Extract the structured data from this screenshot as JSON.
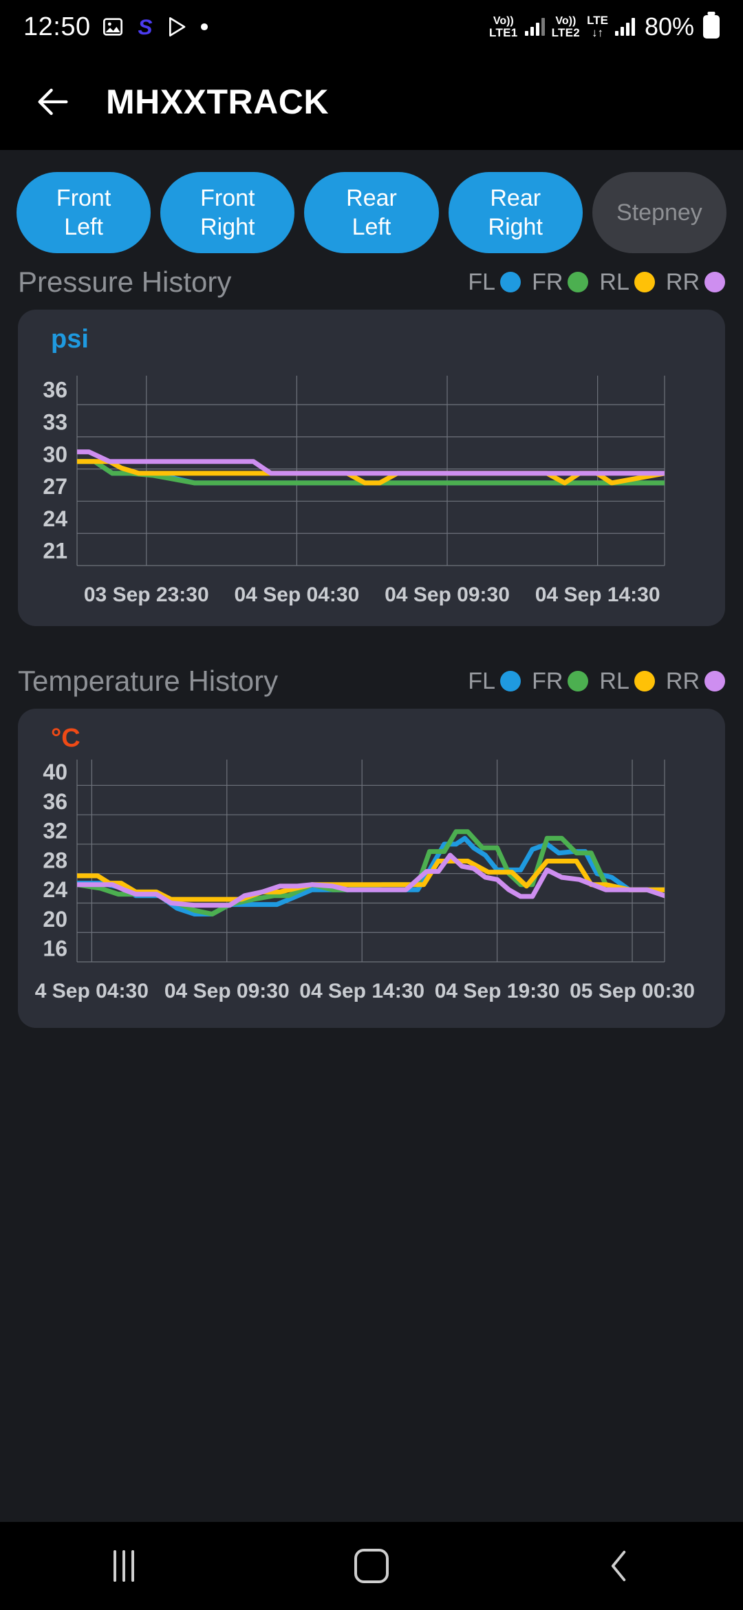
{
  "statusbar": {
    "clock": "12:50",
    "icons": [
      "image-icon",
      "samsung-s-icon",
      "play-store-icon",
      "dot-icon"
    ],
    "sim1": {
      "volte_top": "Vo))",
      "volte_bottom": "LTE1"
    },
    "sim2": {
      "volte_top": "Vo))",
      "volte_bottom": "LTE2",
      "net_top": "LTE",
      "net_bottom": "↓↑"
    },
    "battery_percent": "80%"
  },
  "appbar": {
    "back_label": "back-arrow",
    "title": "MHXXTRACK"
  },
  "chips": [
    {
      "line1": "Front",
      "line2": "Left",
      "active": true
    },
    {
      "line1": "Front",
      "line2": "Right",
      "active": true
    },
    {
      "line1": "Rear",
      "line2": "Left",
      "active": true
    },
    {
      "line1": "Rear",
      "line2": "Right",
      "active": true
    },
    {
      "line1": "Stepney",
      "line2": "",
      "active": false
    }
  ],
  "legend": [
    {
      "label": "FL",
      "color": "#1f9ae0"
    },
    {
      "label": "FR",
      "color": "#4caf50"
    },
    {
      "label": "RL",
      "color": "#ffc107"
    },
    {
      "label": "RR",
      "color": "#ce8ef0"
    }
  ],
  "pressure_section": {
    "title": "Pressure History",
    "unit": "psi",
    "unit_color": "#1f9ae0"
  },
  "temperature_section": {
    "title": "Temperature History",
    "unit": "°C",
    "unit_color": "#ef4a16"
  },
  "navbar": {
    "recents": "recents-button",
    "home": "home-button",
    "back": "back-button"
  },
  "chart_data": [
    {
      "id": "pressure",
      "type": "line",
      "title": "Pressure History",
      "ylabel": "psi",
      "xlabel": "",
      "ylim": [
        19.5,
        37.2
      ],
      "yticks": [
        36,
        33,
        30,
        27,
        24,
        21
      ],
      "grid": true,
      "legend_position": "top-right",
      "xticks": [
        "03 Sep 23:30",
        "04 Sep 04:30",
        "04 Sep 09:30",
        "04 Sep 14:30"
      ],
      "xtick_positions": [
        0.118,
        0.374,
        0.63,
        0.886
      ],
      "series": [
        {
          "name": "FL",
          "color": "#1f9ae0",
          "x": [
            0.0,
            0.03,
            0.06,
            0.09,
            0.13,
            0.2,
            0.3,
            0.4,
            0.5,
            0.6,
            0.7,
            0.8,
            0.9,
            1.0
          ],
          "values": [
            29.2,
            29.2,
            28.1,
            28.1,
            28.1,
            27.2,
            27.2,
            27.2,
            27.2,
            27.2,
            27.2,
            27.2,
            27.2,
            27.2
          ]
        },
        {
          "name": "FR",
          "color": "#4caf50",
          "x": [
            0.0,
            0.03,
            0.06,
            0.09,
            0.13,
            0.2,
            0.3,
            0.4,
            0.5,
            0.6,
            0.7,
            0.8,
            0.9,
            1.0
          ],
          "values": [
            29.2,
            29.2,
            28.1,
            28.1,
            27.9,
            27.2,
            27.2,
            27.2,
            27.2,
            27.2,
            27.2,
            27.2,
            27.2,
            27.2
          ]
        },
        {
          "name": "RL",
          "color": "#ffc107",
          "x": [
            0.0,
            0.03,
            0.055,
            0.075,
            0.105,
            0.17,
            0.33,
            0.46,
            0.49,
            0.515,
            0.545,
            0.8,
            0.83,
            0.855,
            0.885,
            0.91,
            1.0
          ],
          "values": [
            29.2,
            29.2,
            29.2,
            28.6,
            28.1,
            28.1,
            28.1,
            28.1,
            27.2,
            27.2,
            28.1,
            28.1,
            27.2,
            28.1,
            28.1,
            27.2,
            28.1
          ]
        },
        {
          "name": "RR",
          "color": "#ce8ef0",
          "x": [
            0.0,
            0.02,
            0.055,
            0.085,
            0.3,
            0.33,
            0.36,
            0.5,
            0.7,
            0.9,
            1.0
          ],
          "values": [
            30.1,
            30.1,
            29.2,
            29.2,
            29.2,
            28.1,
            28.1,
            28.1,
            28.1,
            28.1,
            28.1
          ]
        }
      ]
    },
    {
      "id": "temperature",
      "type": "line",
      "title": "Temperature History",
      "ylabel": "°C",
      "xlabel": "",
      "ylim": [
        14.0,
        41.5
      ],
      "yticks": [
        40,
        36,
        32,
        28,
        24,
        20,
        16
      ],
      "grid": true,
      "legend_position": "top-right",
      "xticks": [
        "4 Sep 04:30",
        "04 Sep 09:30",
        "04 Sep 14:30",
        "04 Sep 19:30",
        "05 Sep 00:30"
      ],
      "xtick_positions": [
        0.025,
        0.255,
        0.485,
        0.715,
        0.945
      ],
      "series": [
        {
          "name": "FL",
          "color": "#1f9ae0",
          "x": [
            0.0,
            0.04,
            0.08,
            0.1,
            0.14,
            0.17,
            0.2,
            0.23,
            0.26,
            0.3,
            0.34,
            0.4,
            0.46,
            0.52,
            0.58,
            0.6,
            0.625,
            0.645,
            0.66,
            0.675,
            0.695,
            0.715,
            0.735,
            0.755,
            0.775,
            0.8,
            0.82,
            0.845,
            0.865,
            0.885,
            0.91,
            0.94,
            1.0
          ],
          "values": [
            24.7,
            24.7,
            24.0,
            23.0,
            23.0,
            21.3,
            20.5,
            20.5,
            21.8,
            21.8,
            21.8,
            23.8,
            23.8,
            23.8,
            23.8,
            26.5,
            30.0,
            30.0,
            30.8,
            29.5,
            28.5,
            26.5,
            26.5,
            26.5,
            29.3,
            30.0,
            28.8,
            29.0,
            29.0,
            26.0,
            25.5,
            23.8,
            23.8
          ]
        },
        {
          "name": "FR",
          "color": "#4caf50",
          "x": [
            0.0,
            0.04,
            0.07,
            0.1,
            0.14,
            0.17,
            0.2,
            0.23,
            0.26,
            0.3,
            0.335,
            0.36,
            0.4,
            0.435,
            0.46,
            0.52,
            0.58,
            0.6,
            0.625,
            0.645,
            0.665,
            0.69,
            0.715,
            0.735,
            0.755,
            0.775,
            0.8,
            0.825,
            0.85,
            0.875,
            0.9,
            0.94,
            0.97,
            1.0
          ],
          "values": [
            24.5,
            24.0,
            23.2,
            23.2,
            23.2,
            22.0,
            21.0,
            20.5,
            21.8,
            22.5,
            23.0,
            23.0,
            24.5,
            23.8,
            23.8,
            24.5,
            24.5,
            29.0,
            29.0,
            31.7,
            31.7,
            29.5,
            29.5,
            26.0,
            24.5,
            24.5,
            30.8,
            30.8,
            28.8,
            28.8,
            24.5,
            23.8,
            23.8,
            23.0
          ]
        },
        {
          "name": "RL",
          "color": "#ffc107",
          "x": [
            0.0,
            0.035,
            0.055,
            0.075,
            0.1,
            0.135,
            0.16,
            0.2,
            0.28,
            0.315,
            0.345,
            0.4,
            0.44,
            0.5,
            0.56,
            0.59,
            0.615,
            0.645,
            0.665,
            0.7,
            0.715,
            0.74,
            0.765,
            0.8,
            0.825,
            0.85,
            0.875,
            0.9,
            0.94,
            1.0
          ],
          "values": [
            25.7,
            25.7,
            24.7,
            24.7,
            23.5,
            23.5,
            22.5,
            22.5,
            22.5,
            23.5,
            23.5,
            24.5,
            24.5,
            24.5,
            24.5,
            24.5,
            27.7,
            27.7,
            27.7,
            26.2,
            26.2,
            26.2,
            24.3,
            27.7,
            27.7,
            27.7,
            24.5,
            24.5,
            23.8,
            23.8
          ]
        },
        {
          "name": "RR",
          "color": "#ce8ef0",
          "x": [
            0.0,
            0.06,
            0.08,
            0.1,
            0.135,
            0.16,
            0.2,
            0.23,
            0.26,
            0.285,
            0.315,
            0.345,
            0.375,
            0.4,
            0.435,
            0.46,
            0.52,
            0.56,
            0.595,
            0.615,
            0.635,
            0.655,
            0.675,
            0.695,
            0.715,
            0.735,
            0.755,
            0.775,
            0.8,
            0.825,
            0.855,
            0.9,
            0.94,
            0.97,
            1.0
          ],
          "values": [
            24.5,
            24.5,
            23.8,
            23.2,
            23.2,
            22.0,
            21.7,
            21.7,
            21.7,
            23.0,
            23.5,
            24.3,
            24.3,
            24.5,
            24.3,
            23.8,
            23.8,
            23.8,
            26.3,
            26.3,
            28.5,
            27.0,
            26.7,
            25.5,
            25.2,
            23.8,
            22.9,
            22.9,
            26.5,
            25.5,
            25.2,
            23.8,
            23.8,
            23.8,
            23.0
          ]
        }
      ]
    }
  ]
}
